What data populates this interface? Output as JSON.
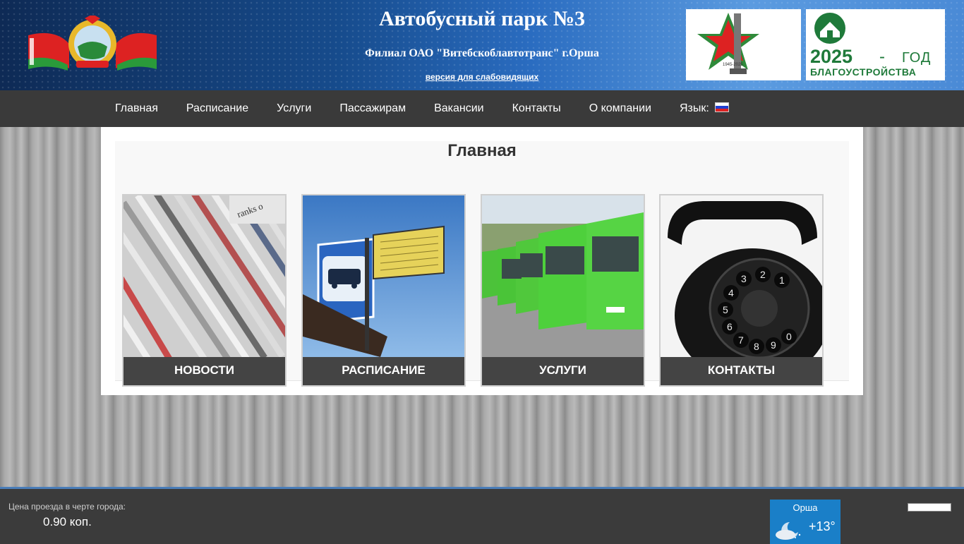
{
  "header": {
    "title": "Автобусный парк №3",
    "subtitle": "Филиал ОАО \"Витебскоблавтотранс\" г.Орша",
    "low_vision_link": "версия для слабовидящих",
    "badge_year": "2025",
    "badge_dash": "-",
    "badge_god": "ГОД",
    "badge_text": "БЛАГОУСТРОЙСТВА",
    "badge1_years": "1945-2025"
  },
  "nav": {
    "items": [
      {
        "label": "Главная"
      },
      {
        "label": "Расписание"
      },
      {
        "label": "Услуги"
      },
      {
        "label": "Пассажирам"
      },
      {
        "label": "Вакансии"
      },
      {
        "label": "Контакты"
      },
      {
        "label": "О компании"
      },
      {
        "label": "Язык:"
      }
    ]
  },
  "main": {
    "title": "Главная",
    "cards": [
      {
        "label": "НОВОСТИ",
        "icon": "newspapers-image"
      },
      {
        "label": "РАСПИСАНИЕ",
        "icon": "bus-stop-sign-image"
      },
      {
        "label": "УСЛУГИ",
        "icon": "green-buses-image"
      },
      {
        "label": "КОНТАКТЫ",
        "icon": "rotary-phone-image"
      }
    ]
  },
  "footer": {
    "fare_label": "Цена проезда в черте города:",
    "fare_value": "0.90 коп.",
    "weather_city": "Орша",
    "weather_temp": "+13°"
  },
  "colors": {
    "nav_bg": "#3a3a3a",
    "card_label_bg": "#444444",
    "weather_bg": "#1a7fc8",
    "badge_green": "#1f7a3a"
  }
}
